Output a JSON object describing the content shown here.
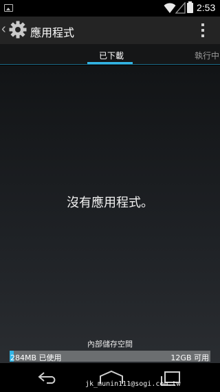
{
  "status_bar": {
    "time": "2:53",
    "icons": [
      "image-notification-icon",
      "wifi-icon",
      "signal-icon",
      "battery-icon"
    ]
  },
  "action_bar": {
    "title": "應用程式",
    "back_glyph": "‹",
    "app_icon": "gear-icon",
    "overflow_icon": "overflow-menu-icon"
  },
  "tabs": [
    {
      "label": "已下載",
      "active": true
    },
    {
      "label": "執行中",
      "active": false
    }
  ],
  "content": {
    "empty_message": "沒有應用程式。"
  },
  "storage": {
    "label": "內部儲存空間",
    "used": "284MB 已使用",
    "free": "12GB 可用",
    "used_fraction": 0.02
  },
  "nav_bar": {
    "icons": [
      "back-icon",
      "home-icon",
      "recents-icon"
    ]
  },
  "watermark": "jk_munin111@sogi.com.tw",
  "colors": {
    "accent": "#33b5e5",
    "action_bar": "#242424",
    "storage_track": "#6b6e70"
  }
}
